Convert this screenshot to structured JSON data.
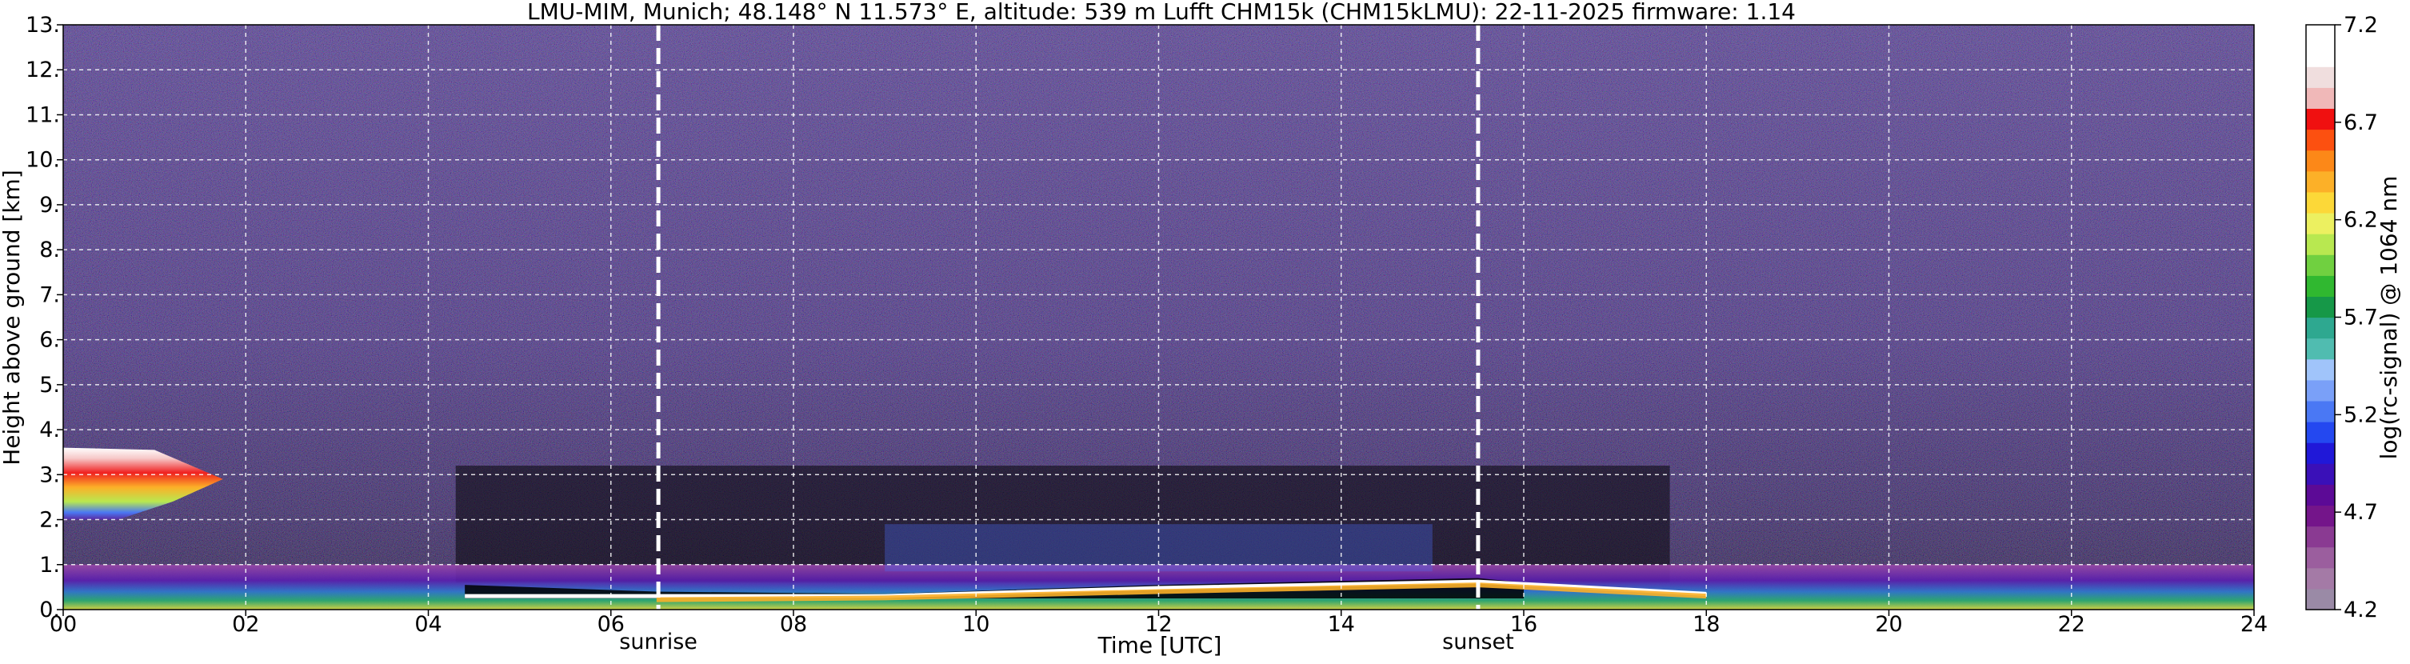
{
  "chart_data": {
    "type": "heatmap",
    "title": "LMU-MIM, Munich; 48.148° N 11.573° E, altitude: 539 m    Lufft CHM15k (CHM15kLMU): 22-11-2025    firmware: 1.14",
    "xlabel": "Time [UTC]",
    "ylabel": "Height above ground [km]",
    "xlim": [
      0,
      24
    ],
    "ylim": [
      0,
      13
    ],
    "grid": true,
    "x_ticks": [
      "00",
      "02",
      "04",
      "06",
      "08",
      "10",
      "12",
      "14",
      "16",
      "18",
      "20",
      "22",
      "24"
    ],
    "y_ticks": [
      "0.",
      "1.",
      "2.",
      "3.",
      "4.",
      "5.",
      "6.",
      "7.",
      "8.",
      "9.",
      "10.",
      "11.",
      "12.",
      "13."
    ],
    "annotations": [
      {
        "label": "sunrise",
        "x": 6.52
      },
      {
        "label": "sunset",
        "x": 15.5
      }
    ],
    "colorbar": {
      "label": "log(rc-signal) @ 1064 nm",
      "range": [
        4.2,
        7.2
      ],
      "ticks": [
        "4.2",
        "4.7",
        "5.2",
        "5.7",
        "6.2",
        "6.7",
        "7.2"
      ],
      "colors": [
        "#9a8aa6",
        "#a47aa6",
        "#9b5e9e",
        "#8a3a92",
        "#74158a",
        "#5c0a96",
        "#3a10b8",
        "#2018d8",
        "#2448f0",
        "#4a78f4",
        "#7aa0f8",
        "#a0c4fa",
        "#50bcb0",
        "#2ea890",
        "#169848",
        "#30b830",
        "#70d040",
        "#b8e850",
        "#ecf060",
        "#fcd838",
        "#fcb028",
        "#fc8818",
        "#fc5010",
        "#f01010",
        "#f0b8b8",
        "#f0dede",
        "#ffffff",
        "#ffffff"
      ]
    },
    "features": [
      {
        "name": "cloud",
        "x": [
          0,
          1.75
        ],
        "y": [
          2.0,
          3.6
        ]
      },
      {
        "name": "boundary layer",
        "x": [
          0,
          24
        ],
        "y": [
          0,
          1.0
        ]
      }
    ]
  }
}
